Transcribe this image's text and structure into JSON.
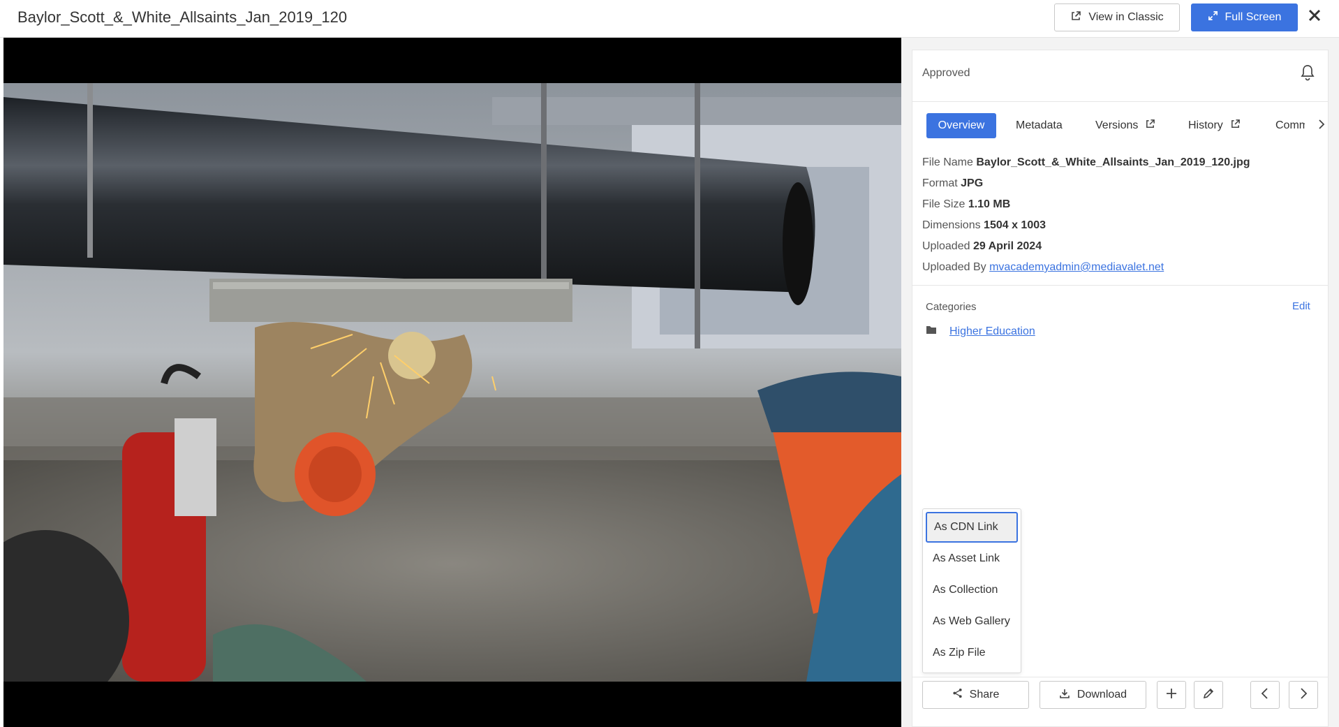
{
  "header": {
    "title": "Baylor_Scott_&_White_Allsaints_Jan_2019_120",
    "view_classic_label": "View in Classic",
    "full_screen_label": "Full Screen"
  },
  "panel": {
    "status": "Approved",
    "tabs": [
      {
        "label": "Overview",
        "active": true
      },
      {
        "label": "Metadata"
      },
      {
        "label": "Versions"
      },
      {
        "label": "History"
      },
      {
        "label": "Comm"
      }
    ],
    "info": {
      "file_name_label": "File Name",
      "file_name": "Baylor_Scott_&_White_Allsaints_Jan_2019_120.jpg",
      "format_label": "Format",
      "format": "JPG",
      "file_size_label": "File Size",
      "file_size": "1.10 MB",
      "dimensions_label": "Dimensions",
      "dimensions": "1504 x 1003",
      "uploaded_label": "Uploaded",
      "uploaded": "29 April 2024",
      "uploaded_by_label": "Uploaded By",
      "uploaded_by": "mvacademyadmin@mediavalet.net"
    },
    "categories": {
      "heading": "Categories",
      "edit_label": "Edit",
      "items": [
        "Higher Education"
      ]
    },
    "share_menu": [
      {
        "label": "As CDN Link",
        "focused": true
      },
      {
        "label": "As Asset Link"
      },
      {
        "label": "As Collection"
      },
      {
        "label": "As Web Gallery"
      },
      {
        "label": "As Zip File"
      }
    ],
    "actions": {
      "share_label": "Share",
      "download_label": "Download"
    }
  },
  "colors": {
    "accent": "#3b73e0",
    "panel_bg": "#f3f3f3",
    "viewer_bg": "#000000"
  }
}
